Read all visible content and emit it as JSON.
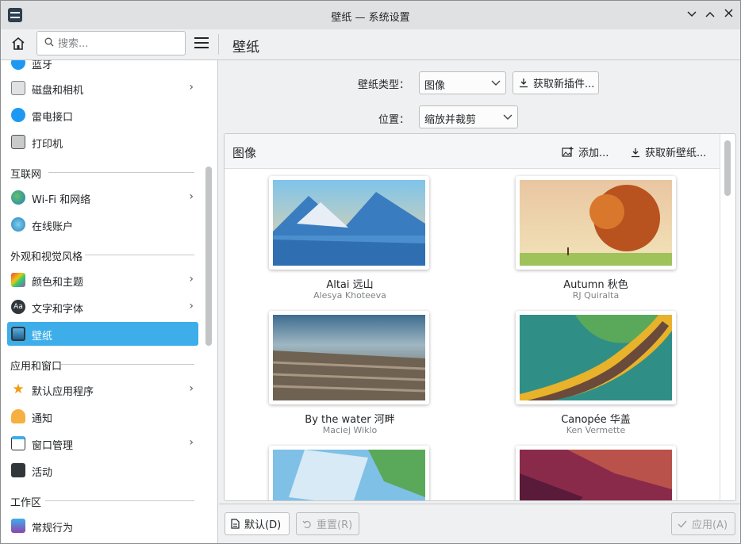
{
  "window": {
    "title": "壁纸 — 系统设置"
  },
  "toolbar": {
    "search_placeholder": "搜索...",
    "page_title": "壁纸"
  },
  "sidebar": {
    "items": [
      {
        "label": "蓝牙",
        "name": "sidebar-item-bluetooth",
        "icon": "bluetooth-icon",
        "chevron": false
      },
      {
        "label": "磁盘和相机",
        "name": "sidebar-item-disks-cameras",
        "icon": "disk-icon",
        "chevron": true
      },
      {
        "label": "雷电接口",
        "name": "sidebar-item-thunderbolt",
        "icon": "thunderbolt-icon",
        "chevron": false
      },
      {
        "label": "打印机",
        "name": "sidebar-item-printers",
        "icon": "printer-icon",
        "chevron": false
      },
      {
        "label": "Wi-Fi 和网络",
        "name": "sidebar-item-wifi",
        "icon": "globe-icon",
        "chevron": true
      },
      {
        "label": "在线账户",
        "name": "sidebar-item-online-accounts",
        "icon": "accounts-icon",
        "chevron": false
      },
      {
        "label": "颜色和主题",
        "name": "sidebar-item-colors-themes",
        "icon": "palette-icon",
        "chevron": true
      },
      {
        "label": "文字和字体",
        "name": "sidebar-item-text-fonts",
        "icon": "font-icon",
        "chevron": true
      },
      {
        "label": "壁纸",
        "name": "sidebar-item-wallpaper",
        "icon": "wallpaper-icon",
        "chevron": false
      },
      {
        "label": "默认应用程序",
        "name": "sidebar-item-default-apps",
        "icon": "star-icon",
        "chevron": true
      },
      {
        "label": "通知",
        "name": "sidebar-item-notifications",
        "icon": "bell-icon",
        "chevron": false
      },
      {
        "label": "窗口管理",
        "name": "sidebar-item-window-management",
        "icon": "window-icon",
        "chevron": true
      },
      {
        "label": "活动",
        "name": "sidebar-item-activities",
        "icon": "activities-icon",
        "chevron": false
      },
      {
        "label": "常规行为",
        "name": "sidebar-item-general-behavior",
        "icon": "general-behavior-icon",
        "chevron": false
      }
    ],
    "categories": [
      "互联网",
      "外观和视觉风格",
      "应用和窗口",
      "工作区"
    ]
  },
  "form": {
    "type_label": "壁纸类型：",
    "type_value": "图像",
    "get_plugins": "获取新插件...",
    "position_label": "位置：",
    "position_value": "缩放并裁剪"
  },
  "panel": {
    "title": "图像",
    "add": "添加...",
    "get_wallpapers": "获取新壁纸..."
  },
  "wallpapers": [
    {
      "name": "Altai 远山",
      "author": "Alesya Khoteeva"
    },
    {
      "name": "Autumn 秋色",
      "author": "RJ Quiralta"
    },
    {
      "name": "By the water 河畔",
      "author": "Maciej Wiklo"
    },
    {
      "name": "Canopée 华盖",
      "author": "Ken Vermette"
    }
  ],
  "footer": {
    "default": "默认(D)",
    "reset": "重置(R)",
    "apply": "应用(A)"
  },
  "colors": {
    "accent": "#3daee9",
    "window_bg": "#eff0f1"
  }
}
